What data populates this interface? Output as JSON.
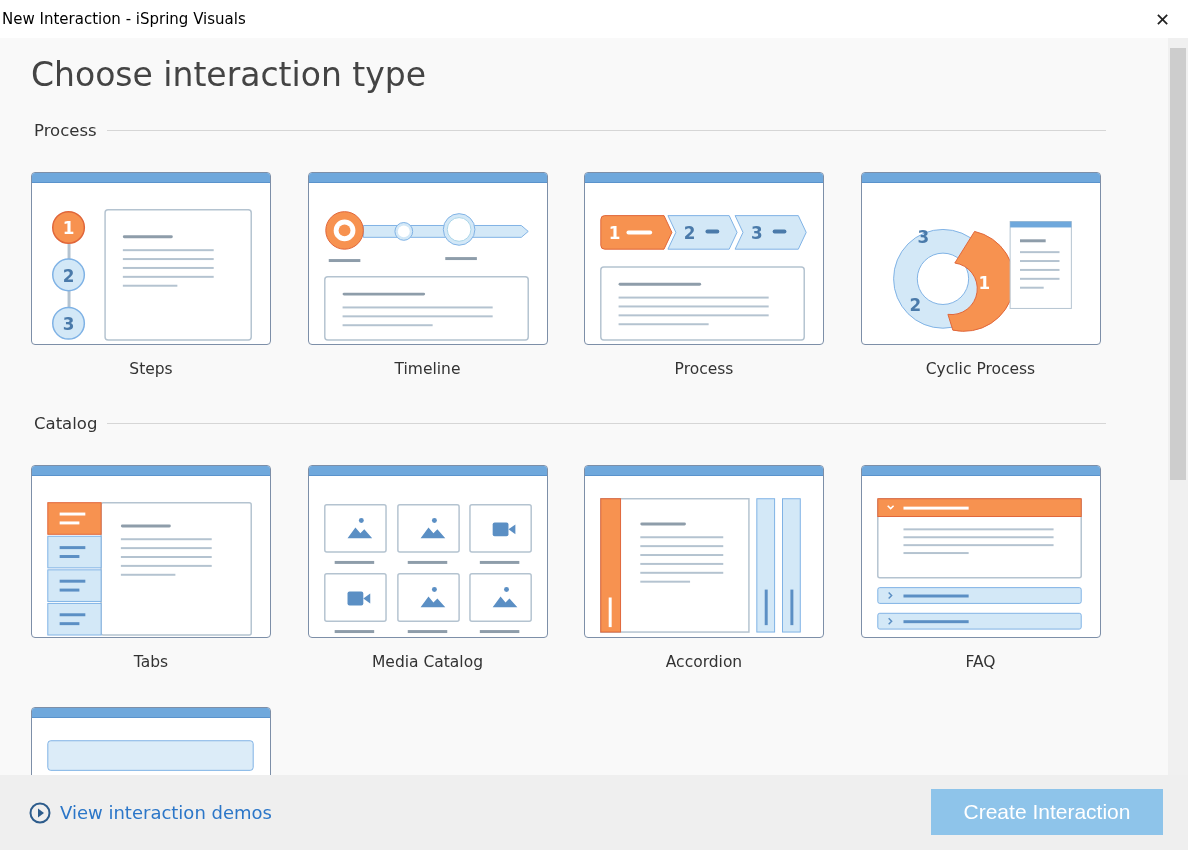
{
  "window": {
    "title": "New Interaction - iSpring Visuals",
    "close": "✕"
  },
  "heading": "Choose interaction type",
  "sections": [
    {
      "title": "Process",
      "items": [
        {
          "label": "Steps",
          "kind": "steps",
          "numbers": [
            "1",
            "2",
            "3"
          ]
        },
        {
          "label": "Timeline",
          "kind": "timeline"
        },
        {
          "label": "Process",
          "kind": "process",
          "numbers": [
            "1",
            "2",
            "3"
          ]
        },
        {
          "label": "Cyclic Process",
          "kind": "cyclic",
          "numbers": [
            "1",
            "2",
            "3"
          ]
        }
      ]
    },
    {
      "title": "Catalog",
      "items": [
        {
          "label": "Tabs",
          "kind": "tabs"
        },
        {
          "label": "Media Catalog",
          "kind": "media"
        },
        {
          "label": "Accordion",
          "kind": "accordion"
        },
        {
          "label": "FAQ",
          "kind": "faq"
        }
      ]
    },
    {
      "items": [
        {
          "kind": "alphabet"
        }
      ]
    }
  ],
  "footer": {
    "link": "View interaction demos",
    "button": {
      "label": "Create Interaction",
      "disabled": true
    }
  }
}
